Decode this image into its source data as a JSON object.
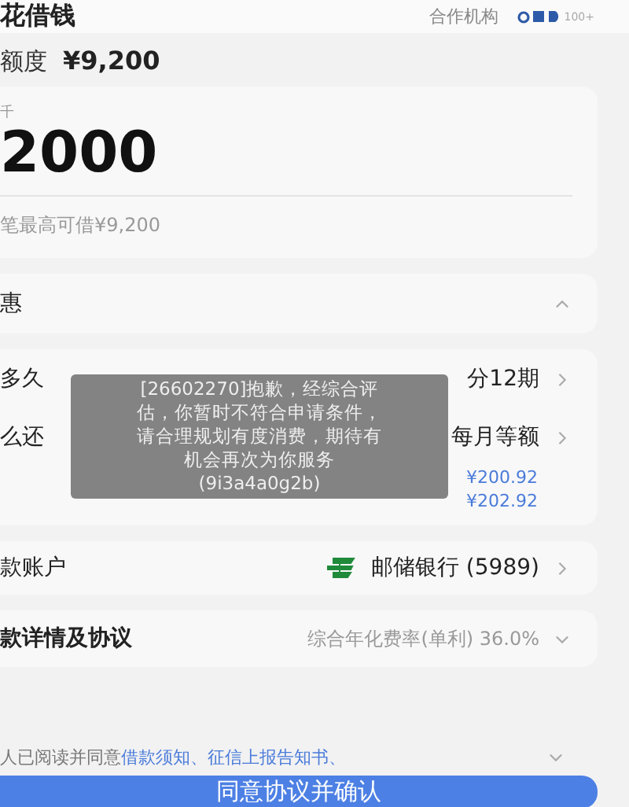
{
  "header": {
    "title": "花借钱",
    "partner_label": "合作机构",
    "partner_count": "100+"
  },
  "limit": {
    "label": "额度",
    "value": "¥9,200"
  },
  "amount": {
    "unit": "千",
    "value": "2000",
    "hint": "笔最高可借¥9,200"
  },
  "discount": {
    "label": "惠",
    "expanded": true
  },
  "terms": [
    {
      "label": "多久",
      "value": "分12期"
    },
    {
      "label": "么还",
      "value": "每月等额",
      "amounts": [
        "¥200.92",
        "¥202.92"
      ]
    }
  ],
  "account": {
    "label": "款账户",
    "bank": "邮储银行 (5989)"
  },
  "details": {
    "label": "款详情及协议",
    "rate": "综合年化费率(单利) 36.0%",
    "expanded": false
  },
  "agreement": {
    "text": "人已阅读并同意",
    "link": "借款须知、征信上报告知书、"
  },
  "confirm": "同意协议并确认",
  "toast": {
    "lines": [
      "[26602270]抱歉，经综合评",
      "估，你暂时不符合申请条件，",
      "请合理规划有度消费，期待有",
      "机会再次为你服务",
      "(9i3a4a0g2b)"
    ]
  }
}
